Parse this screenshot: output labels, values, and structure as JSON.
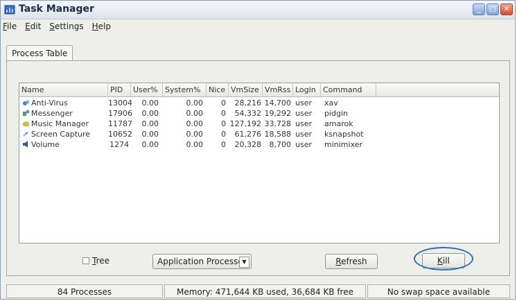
{
  "window": {
    "title": "Task Manager",
    "icon": "task-manager-icon"
  },
  "menu": {
    "items": [
      {
        "first": "F",
        "rest": "ile"
      },
      {
        "first": "E",
        "rest": "dit"
      },
      {
        "first": "S",
        "rest": "ettings"
      },
      {
        "first": "H",
        "rest": "elp"
      }
    ]
  },
  "tab": {
    "label": "Process Table"
  },
  "table": {
    "columns": [
      "Name",
      "PID",
      "User%",
      "System%",
      "Nice",
      "VmSize",
      "VmRss",
      "Login",
      "Command"
    ],
    "rows": [
      {
        "icon": "antivirus-icon",
        "name": "Anti-Virus",
        "pid": "13004",
        "user": "0.00",
        "system": "0.00",
        "nice": "0",
        "vmsize": "28,216",
        "vmrss": "14,700",
        "login": "user",
        "command": "xav"
      },
      {
        "icon": "messenger-icon",
        "name": "Messenger",
        "pid": "17906",
        "user": "0.00",
        "system": "0.00",
        "nice": "0",
        "vmsize": "54,332",
        "vmrss": "19,292",
        "login": "user",
        "command": "pidgin"
      },
      {
        "icon": "music-icon",
        "name": "Music Manager",
        "pid": "11787",
        "user": "0.00",
        "system": "0.00",
        "nice": "0",
        "vmsize": "127,192",
        "vmrss": "33,728",
        "login": "user",
        "command": "amarok"
      },
      {
        "icon": "camera-icon",
        "name": "Screen Capture",
        "pid": "10652",
        "user": "0.00",
        "system": "0.00",
        "nice": "0",
        "vmsize": "61,276",
        "vmrss": "18,588",
        "login": "user",
        "command": "ksnapshot"
      },
      {
        "icon": "speaker-icon",
        "name": "Volume",
        "pid": "1274",
        "user": "0.00",
        "system": "0.00",
        "nice": "0",
        "vmsize": "20,328",
        "vmrss": "8,700",
        "login": "user",
        "command": "minimixer"
      }
    ]
  },
  "controls": {
    "tree_first": "T",
    "tree_rest": "ree",
    "tree_checked": false,
    "filter_value": "Application Processes",
    "refresh_first": "R",
    "refresh_rest": "efresh",
    "kill_first": "K",
    "kill_rest": "ill"
  },
  "status": {
    "processes": "84 Processes",
    "memory": "Memory: 471,644 KB used, 36,684 KB free",
    "swap": "No swap space available"
  },
  "colors": {
    "annotation": "#2a6fb5",
    "title_bar": "#dfe4ec"
  }
}
